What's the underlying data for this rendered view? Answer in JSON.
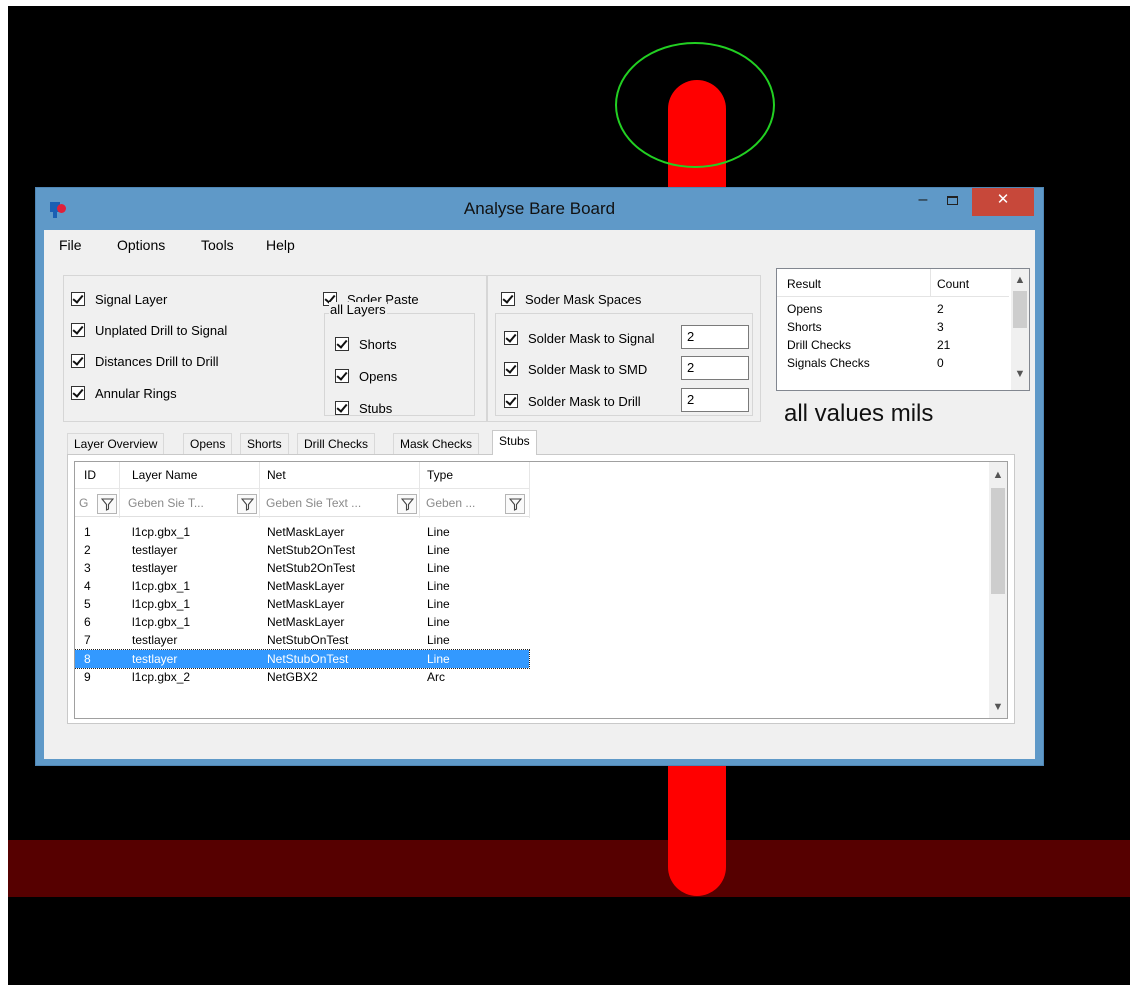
{
  "window": {
    "title": "Analyse Bare Board",
    "minimize": "–",
    "close": "✕"
  },
  "menu": [
    "File",
    "Options",
    "Tools",
    "Help"
  ],
  "checks": {
    "signal_layer": "Signal Layer",
    "unplated_drill": "Unplated Drill to Signal",
    "drill_to_drill": "Distances Drill to Drill",
    "annular_rings": "Annular Rings",
    "soder_paste": "Soder Paste",
    "all_layers_caption": "all Layers",
    "shorts": "Shorts",
    "opens": "Opens",
    "stubs": "Stubs",
    "soder_mask_spaces": "Soder Mask Spaces",
    "mask_to_signal": "Solder Mask to Signal",
    "mask_to_smd": "Solder Mask to SMD",
    "mask_to_drill": "Solder Mask to Drill"
  },
  "inputs": {
    "mask_to_signal": "2",
    "mask_to_smd": "2",
    "mask_to_drill": "2"
  },
  "result_grid": {
    "headers": [
      "Result",
      "Count"
    ],
    "rows": [
      [
        "Opens",
        "2"
      ],
      [
        "Shorts",
        "3"
      ],
      [
        "Drill Checks",
        "21"
      ],
      [
        "Signals Checks",
        "0"
      ]
    ]
  },
  "units_label": "all values mils",
  "tabs": [
    "Layer Overview",
    "Opens",
    "Shorts",
    "Drill Checks",
    "Mask Checks",
    "Stubs"
  ],
  "stubs_grid": {
    "headers": [
      "ID",
      "Layer Name",
      "Net",
      "Type"
    ],
    "filters": [
      "G",
      "Geben Sie T...",
      "Geben Sie Text ...",
      "Geben ..."
    ],
    "rows": [
      [
        "1",
        "l1cp.gbx_1",
        "NetMaskLayer",
        "Line"
      ],
      [
        "2",
        "testlayer",
        "NetStub2OnTest",
        "Line"
      ],
      [
        "3",
        "testlayer",
        "NetStub2OnTest",
        "Line"
      ],
      [
        "4",
        "l1cp.gbx_1",
        "NetMaskLayer",
        "Line"
      ],
      [
        "5",
        "l1cp.gbx_1",
        "NetMaskLayer",
        "Line"
      ],
      [
        "6",
        "l1cp.gbx_1",
        "NetMaskLayer",
        "Line"
      ],
      [
        "7",
        "testlayer",
        "NetStubOnTest",
        "Line"
      ],
      [
        "8",
        "testlayer",
        "NetStubOnTest",
        "Line"
      ],
      [
        "9",
        "l1cp.gbx_2",
        "NetGBX2",
        "Arc"
      ]
    ],
    "selected_row": 7
  },
  "colors": {
    "pcb_trace": "#ff0000",
    "pcb_band": "#560000",
    "marker": "#22d022",
    "selection": "#3399ff",
    "title_bar": "#5f99c8",
    "close_button": "#c7483a"
  }
}
